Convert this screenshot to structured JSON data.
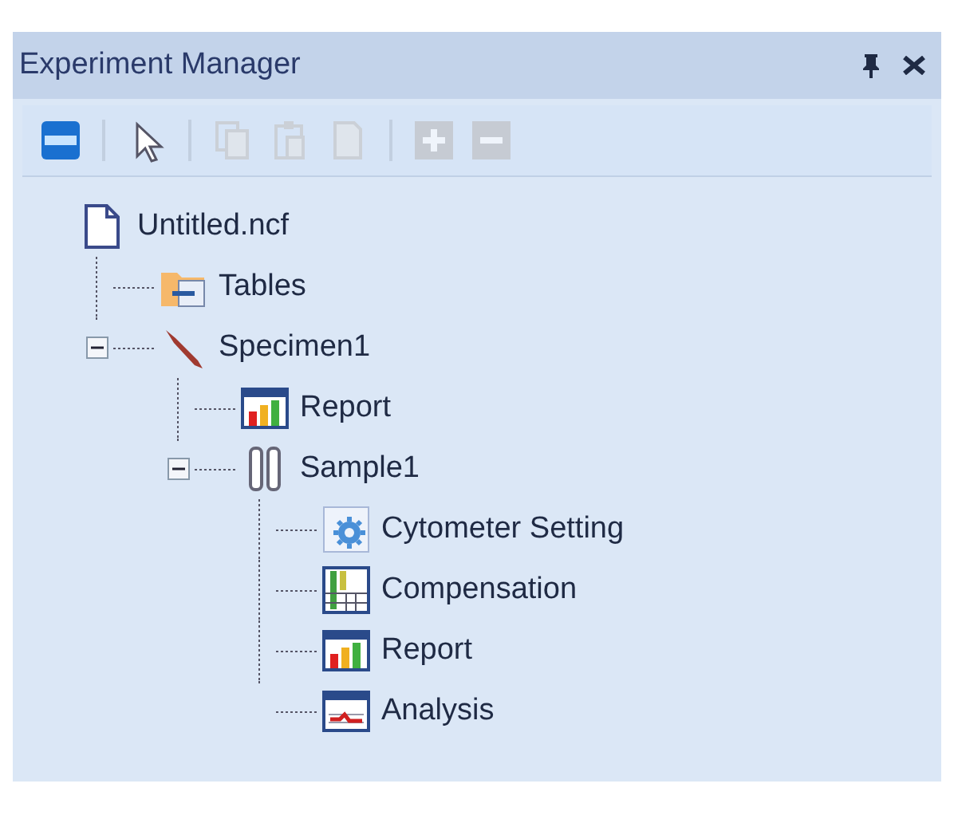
{
  "window": {
    "title": "Experiment Manager"
  },
  "title_buttons": [
    {
      "kind": "pin"
    },
    {
      "kind": "close"
    }
  ],
  "toolbar": [
    {
      "kind": "view",
      "disabled": false
    },
    {
      "kind": "separator"
    },
    {
      "kind": "pointer",
      "disabled": false
    },
    {
      "kind": "separator"
    },
    {
      "kind": "copy",
      "disabled": true
    },
    {
      "kind": "paste",
      "disabled": true
    },
    {
      "kind": "page",
      "disabled": true
    },
    {
      "kind": "separator"
    },
    {
      "kind": "add",
      "disabled": true
    },
    {
      "kind": "remove",
      "disabled": true
    }
  ],
  "tree": {
    "label": "Untitled.ncf",
    "kind": "document",
    "children": [
      {
        "label": "Tables",
        "kind": "tables"
      },
      {
        "label": "Specimen1",
        "kind": "pipette",
        "expanded": true,
        "children": [
          {
            "label": "Report",
            "kind": "report"
          },
          {
            "label": "Sample1",
            "kind": "tubes",
            "expanded": true,
            "children": [
              {
                "label": "Cytometer Setting",
                "kind": "settings"
              },
              {
                "label": "Compensation",
                "kind": "compensation"
              },
              {
                "label": "Report",
                "kind": "report"
              },
              {
                "label": "Analysis",
                "kind": "analysis"
              }
            ]
          }
        ]
      }
    ]
  }
}
